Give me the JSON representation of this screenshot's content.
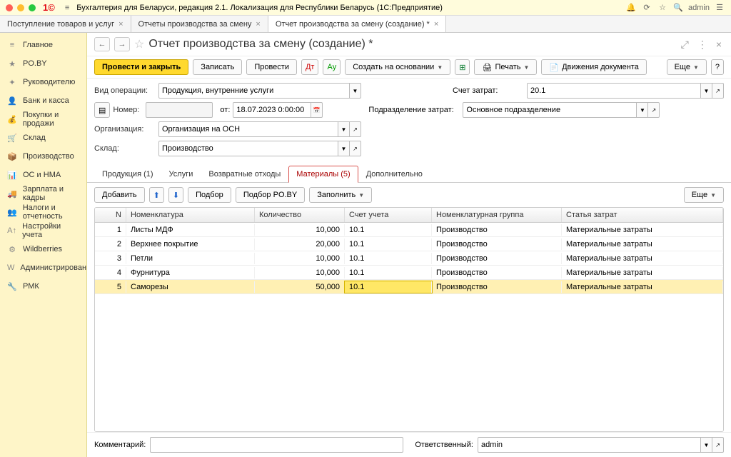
{
  "titlebar": {
    "app": "Бухгалтерия для Беларуси, редакция 2.1. Локализация для Республики Беларусь   (1С:Предприятие)",
    "user": "admin"
  },
  "docTabs": [
    {
      "label": "Поступление товаров и услуг"
    },
    {
      "label": "Отчеты производства за смену"
    },
    {
      "label": "Отчет производства за смену (создание) *",
      "active": true
    }
  ],
  "sidebar": [
    "Главное",
    "PO.BY",
    "Руководителю",
    "Банк и касса",
    "Покупки и продажи",
    "Склад",
    "Производство",
    "ОС и НМА",
    "Зарплата и кадры",
    "Налоги и отчетность",
    "Настройки учета",
    "Wildberries",
    "Администрирование",
    "РМК"
  ],
  "formTitle": "Отчет производства за смену (создание) *",
  "toolbar": {
    "post_close": "Провести и закрыть",
    "write": "Записать",
    "post": "Провести",
    "create_based": "Создать на основании",
    "print": "Печать",
    "movements": "Движения документа",
    "more": "Еще"
  },
  "fields": {
    "op_label": "Вид операции:",
    "op_value": "Продукция, внутренние услуги",
    "num_label": "Номер:",
    "from_label": "от:",
    "date": "18.07.2023 0:00:00",
    "org_label": "Организация:",
    "org_value": "Организация на ОСН",
    "wh_label": "Склад:",
    "wh_value": "Производство",
    "cost_acc_label": "Счет затрат:",
    "cost_acc_value": "20.1",
    "dept_label": "Подразделение затрат:",
    "dept_value": "Основное подразделение"
  },
  "subtabs": [
    "Продукция (1)",
    "Услуги",
    "Возвратные отходы",
    "Материалы (5)",
    "Дополнительно"
  ],
  "subtoolbar": {
    "add": "Добавить",
    "pick": "Подбор",
    "pick_poby": "Подбор PO.BY",
    "fill": "Заполнить",
    "more": "Еще"
  },
  "gridHeaders": {
    "n": "N",
    "nom": "Номенклатура",
    "qty": "Количество",
    "acc": "Счет учета",
    "grp": "Номенклатурная группа",
    "cost": "Статья затрат"
  },
  "rows": [
    {
      "n": 1,
      "nom": "Листы МДФ",
      "qty": "10,000",
      "acc": "10.1",
      "grp": "Производство",
      "cost": "Материальные затраты"
    },
    {
      "n": 2,
      "nom": "Верхнее покрытие",
      "qty": "20,000",
      "acc": "10.1",
      "grp": "Производство",
      "cost": "Материальные затраты"
    },
    {
      "n": 3,
      "nom": "Петли",
      "qty": "10,000",
      "acc": "10.1",
      "grp": "Производство",
      "cost": "Материальные затраты"
    },
    {
      "n": 4,
      "nom": "Фурнитура",
      "qty": "10,000",
      "acc": "10.1",
      "grp": "Производство",
      "cost": "Материальные затраты"
    },
    {
      "n": 5,
      "nom": "Саморезы",
      "qty": "50,000",
      "acc": "10.1",
      "grp": "Производство",
      "cost": "Материальные затраты",
      "sel": true
    }
  ],
  "footer": {
    "comment_label": "Комментарий:",
    "resp_label": "Ответственный:",
    "resp_value": "admin"
  }
}
